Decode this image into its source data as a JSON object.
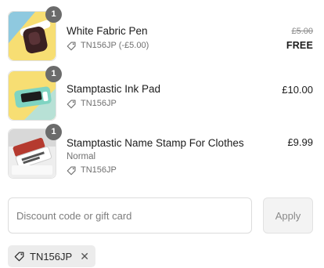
{
  "line_items": [
    {
      "quantity": "1",
      "title": "White Fabric Pen",
      "variant": "",
      "discount_code": "TN156JP (-£5.00)",
      "original_price": "£5.00",
      "price": "FREE",
      "thumb_icon": "fabric-pen-image"
    },
    {
      "quantity": "1",
      "title": "Stamptastic Ink Pad",
      "variant": "",
      "discount_code": "TN156JP",
      "price": "£10.00",
      "thumb_icon": "ink-pad-image"
    },
    {
      "quantity": "1",
      "title": "Stamptastic Name Stamp For Clothes",
      "variant": "Normal",
      "discount_code": "TN156JP",
      "price": "£9.99",
      "thumb_icon": "name-stamp-image"
    }
  ],
  "discount": {
    "placeholder": "Discount code or gift card",
    "value": "",
    "apply_label": "Apply"
  },
  "applied_code": {
    "label": "TN156JP",
    "remove_glyph": "✕"
  },
  "colors": {
    "badge": "#6b6b6b",
    "thumb_bg_yellow": "#f7de73",
    "thumb_bg_green": "#b8e1d6",
    "tag_bg": "#ececec"
  }
}
